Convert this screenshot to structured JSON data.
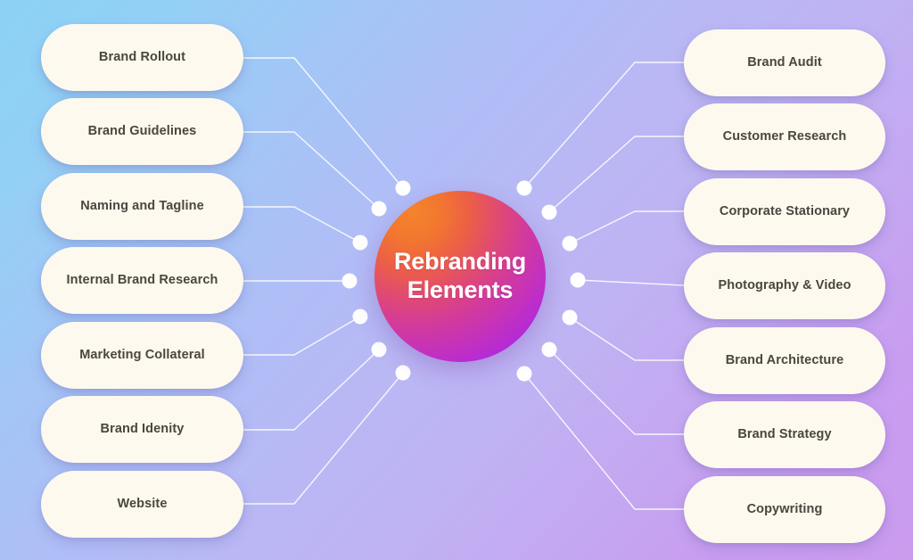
{
  "diagram": {
    "type": "mind-map",
    "title": "Rebranding Elements",
    "hub": {
      "label": "Rebranding\nElements",
      "gradient_from": "#F5832C",
      "gradient_to": "#9B22F0",
      "text_color": "#FFFFFF"
    },
    "background": {
      "gradient_from": "#8CD2F5",
      "gradient_mid": "#BAB7F4",
      "gradient_to": "#CB9BEE"
    },
    "card_style": {
      "fill": "#FDF9EE",
      "text_color": "#4A4640"
    },
    "connector_color": "#FFFFFF",
    "node_color": "#FFFFFF",
    "left_branches": [
      {
        "label": "Brand Rollout"
      },
      {
        "label": "Brand Guidelines"
      },
      {
        "label": "Naming and Tagline"
      },
      {
        "label": "Internal Brand Research"
      },
      {
        "label": "Marketing Collateral"
      },
      {
        "label": "Brand Idenity"
      },
      {
        "label": "Website"
      }
    ],
    "right_branches": [
      {
        "label": "Brand Audit"
      },
      {
        "label": "Customer Research"
      },
      {
        "label": "Corporate Stationary"
      },
      {
        "label": "Photography & Video"
      },
      {
        "label": "Brand Architecture"
      },
      {
        "label": "Brand Strategy"
      },
      {
        "label": "Copywriting"
      }
    ]
  }
}
